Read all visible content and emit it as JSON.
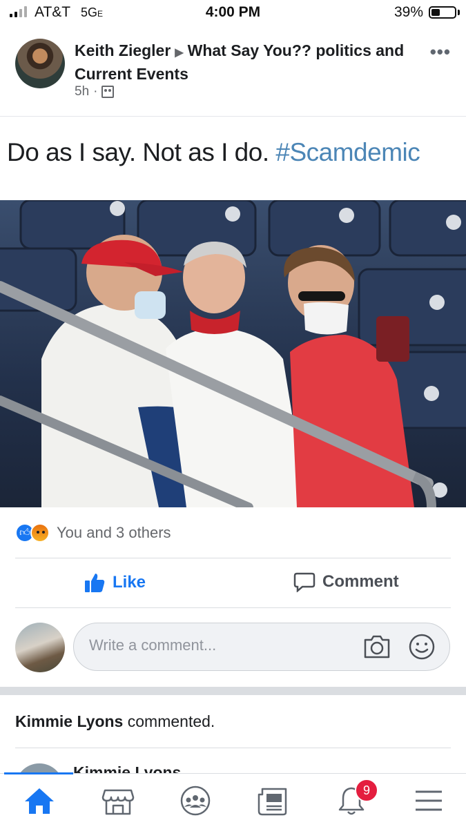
{
  "status_bar": {
    "carrier": "AT&T",
    "network": "5G",
    "network_suffix": "E",
    "time": "4:00 PM",
    "battery_percent": "39%",
    "battery_level": 0.39
  },
  "post": {
    "author": "Keith Ziegler",
    "group": "What Say You?? politics and  Current Events",
    "time_ago": "5h",
    "separator": "·",
    "text": "Do as I say. Not as I do.",
    "hashtag": "#Scamdemic",
    "more_icon": "more-horizontal-icon",
    "privacy_icon": "group-icon"
  },
  "reactions": {
    "icons": [
      "like-reaction-icon",
      "angry-reaction-icon"
    ],
    "summary": "You and 3 others"
  },
  "actions": {
    "like_label": "Like",
    "comment_label": "Comment"
  },
  "composer": {
    "placeholder": "Write a comment...",
    "camera_icon": "camera-icon",
    "emoji_icon": "smiley-icon"
  },
  "activity": {
    "commenter": "Kimmie Lyons",
    "action": "commented."
  },
  "comment_preview": {
    "name": "Kimmie Lyons"
  },
  "bottom_nav": {
    "items": [
      "home-icon",
      "marketplace-icon",
      "groups-icon",
      "news-feed-icon",
      "notifications-icon",
      "menu-icon"
    ],
    "notification_count": "9"
  },
  "colors": {
    "accent": "#1877f2",
    "hashtag": "#4c86b6",
    "badge": "#e41e3f"
  }
}
